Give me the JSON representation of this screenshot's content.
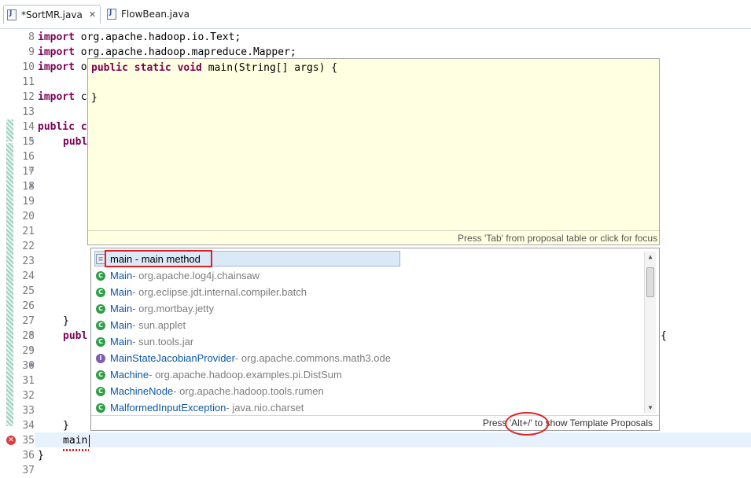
{
  "tabs": [
    {
      "label": "*SortMR.java",
      "close": "✕",
      "icon": "java-file-icon"
    },
    {
      "label": "FlowBean.java",
      "icon": "java-file-icon"
    }
  ],
  "line_numbers": [
    "8",
    "9",
    "10",
    "11",
    "12",
    "13",
    "14",
    "15",
    "16",
    "17",
    "18",
    "19",
    "20",
    "21",
    "22",
    "23",
    "24",
    "25",
    "26",
    "27",
    "28",
    "29",
    "30",
    "31",
    "32",
    "33",
    "34",
    "35",
    "36",
    "37"
  ],
  "code": {
    "l8": "org.apache.hadoop.io.Text;",
    "l9": "org.apache.hadoop.mapreduce.Mapper;",
    "l10": "o",
    "l12": "c",
    "l14": "c",
    "l15": "publ",
    "l27": "}",
    "l28": "publ",
    "l28_tail": "{",
    "l34": "}",
    "l35": "main",
    "l36": "}",
    "kw_import": "import",
    "kw_public": "public"
  },
  "preview": {
    "line1_kw": "public static void",
    "line1_rest": " main(String[] args) {",
    "line2": "}",
    "footer": "Press 'Tab' from proposal table or click for focus"
  },
  "proposals": {
    "selected": "main - main method",
    "items": [
      {
        "name": "Main",
        "pkg": " - org.apache.log4j.chainsaw"
      },
      {
        "name": "Main",
        "pkg": " - org.eclipse.jdt.internal.compiler.batch"
      },
      {
        "name": "Main",
        "pkg": " - org.mortbay.jetty"
      },
      {
        "name": "Main",
        "pkg": " - sun.applet"
      },
      {
        "name": "Main",
        "pkg": " - sun.tools.jar"
      },
      {
        "name": "MainStateJacobianProvider",
        "pkg": " - org.apache.commons.math3.ode"
      },
      {
        "name": "Machine",
        "pkg": " - org.apache.hadoop.examples.pi.DistSum"
      },
      {
        "name": "MachineNode",
        "pkg": " - org.apache.hadoop.tools.rumen"
      },
      {
        "name": "MalformedInputException",
        "pkg": " - java.nio.charset"
      }
    ],
    "footer": "Press 'Alt+/' to show Template Proposals"
  }
}
